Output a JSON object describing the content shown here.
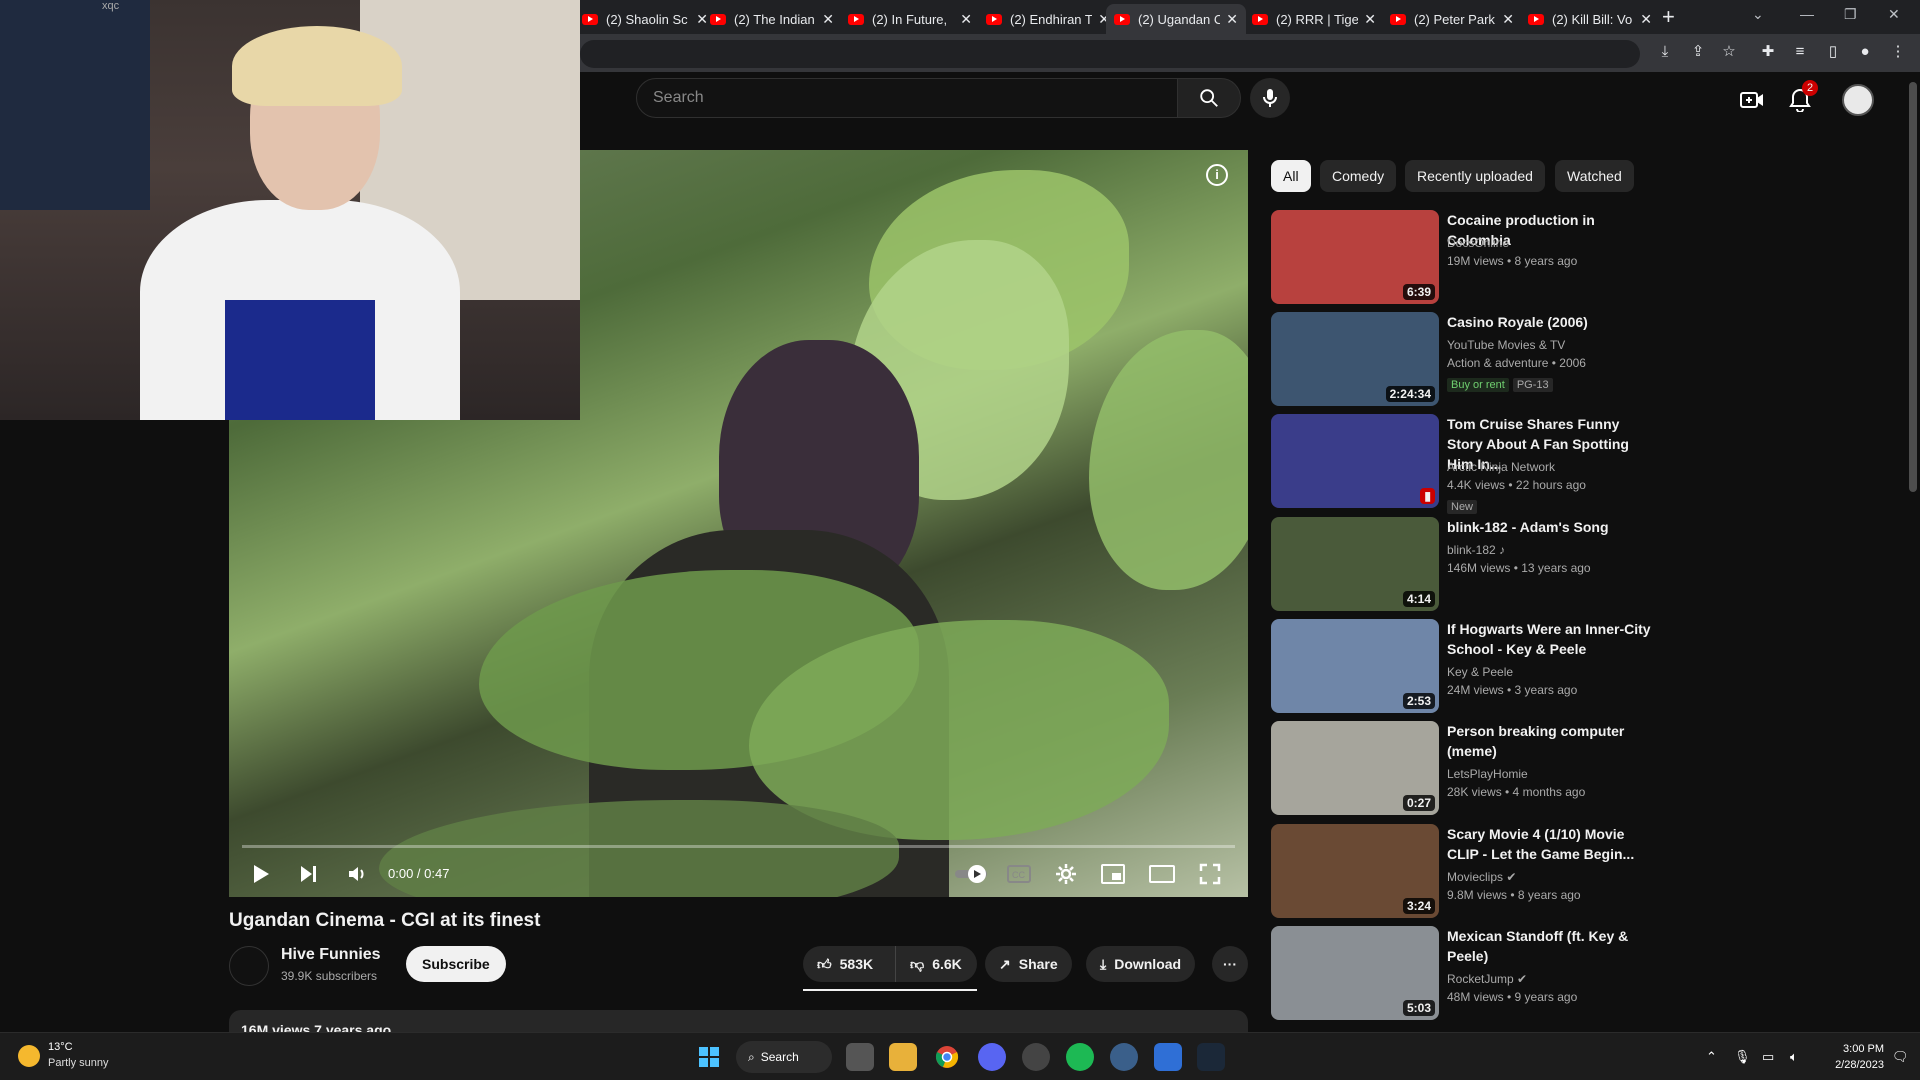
{
  "browser": {
    "tabs": [
      {
        "label": "(2) Shaolin Sc",
        "active": false
      },
      {
        "label": "(2) The Indian",
        "active": false
      },
      {
        "label": "(2) In Future,",
        "active": false
      },
      {
        "label": "(2) Endhiran T",
        "active": false
      },
      {
        "label": "(2) Ugandan C",
        "active": true
      },
      {
        "label": "(2) RRR | Tige",
        "active": false
      },
      {
        "label": "(2) Peter Park",
        "active": false
      },
      {
        "label": "(2) Kill Bill: Vo",
        "active": false
      }
    ],
    "new_tab": "+",
    "close_glyph": "✕"
  },
  "youtube": {
    "search_placeholder": "Search",
    "notifications_count": "2"
  },
  "webcam": {
    "label": "xqc"
  },
  "player": {
    "time": "0:00 / 0:47",
    "progress": 0.0
  },
  "video": {
    "title": "Ugandan Cinema - CGI at its finest",
    "channel": "Hive Funnies",
    "subscribers": "39.9K subscribers",
    "subscribe_label": "Subscribe",
    "likes": "583K",
    "dislikes": "6.6K",
    "share_label": "Share",
    "download_label": "Download",
    "more_label": "···",
    "views": "16M views  7 years ago"
  },
  "chips": [
    "All",
    "Comedy",
    "Recently uploaded",
    "Watched"
  ],
  "recommendations": [
    {
      "title": "Cocaine production in Colombia",
      "channel": "DocsOnline",
      "meta": "19M views • 8 years ago",
      "duration": "6:39",
      "thumb_color": "#b8413e"
    },
    {
      "title": "Casino Royale (2006)",
      "channel": "YouTube Movies & TV",
      "meta": "Action & adventure • 2006",
      "duration": "2:24:34",
      "thumb_color": "#3d5570",
      "tag1": "Buy or rent",
      "tag2": "PG-13"
    },
    {
      "title": "Tom Cruise Shares Funny Story About A Fan Spotting Him In...",
      "channel": "Arctic Ninja Network",
      "meta": "4.4K views • 22 hours ago",
      "duration": "",
      "thumb_color": "#3a3d8a",
      "tag1": "New"
    },
    {
      "title": "blink-182 - Adam's Song",
      "channel": "blink-182 ♪",
      "meta": "146M views • 13 years ago",
      "duration": "4:14",
      "thumb_color": "#4a5a3a"
    },
    {
      "title": "If Hogwarts Were an Inner-City School - Key & Peele",
      "channel": "Key & Peele",
      "meta": "24M views • 3 years ago",
      "duration": "2:53",
      "thumb_color": "#6f86a8"
    },
    {
      "title": "Person breaking computer (meme)",
      "channel": "LetsPlayHomie",
      "meta": "28K views • 4 months ago",
      "duration": "0:27",
      "thumb_color": "#a6a59c"
    },
    {
      "title": "Scary Movie 4 (1/10) Movie CLIP - Let the Game Begin...",
      "channel": "Movieclips ✔",
      "meta": "9.8M views • 8 years ago",
      "duration": "3:24",
      "thumb_color": "#6a4a34"
    },
    {
      "title": "Mexican Standoff (ft. Key & Peele)",
      "channel": "RocketJump ✔",
      "meta": "48M views • 9 years ago",
      "duration": "5:03",
      "thumb_color": "#8a8f94"
    }
  ],
  "taskbar": {
    "temp": "13°C",
    "weather": "Partly sunny",
    "search_label": "Search",
    "time": "3:00 PM",
    "date": "2/28/2023"
  },
  "colors": {
    "accent_red": "#ff0000",
    "bg": "#0f0f0f"
  }
}
